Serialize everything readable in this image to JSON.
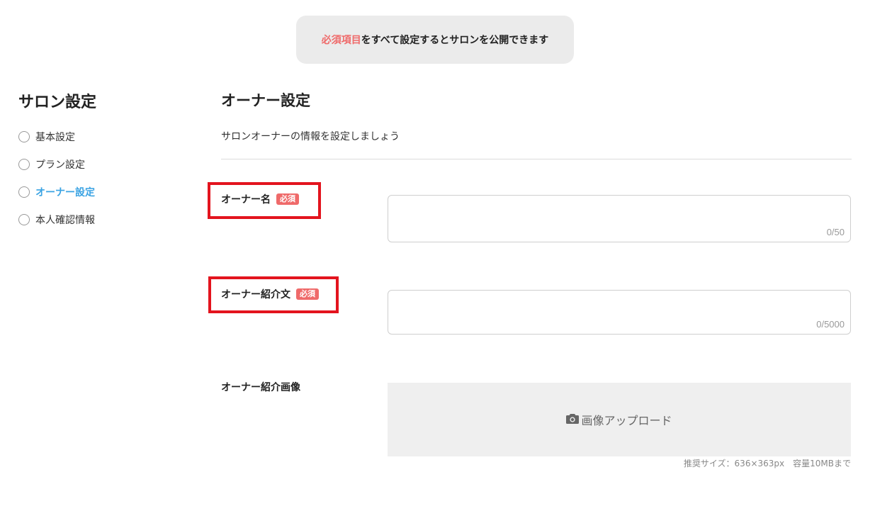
{
  "notice": {
    "required_text": "必須項目",
    "rest_text": "をすべて設定するとサロンを公開できます"
  },
  "sidebar": {
    "title": "サロン設定",
    "items": [
      {
        "label": "基本設定"
      },
      {
        "label": "プラン設定"
      },
      {
        "label": "オーナー設定"
      },
      {
        "label": "本人確認情報"
      }
    ]
  },
  "main": {
    "title": "オーナー設定",
    "subtitle": "サロンオーナーの情報を設定しましょう",
    "owner_name": {
      "label": "オーナー名",
      "badge": "必須",
      "value": "",
      "counter": "0/50"
    },
    "owner_intro": {
      "label": "オーナー紹介文",
      "badge": "必須",
      "value": "",
      "counter": "0/5000"
    },
    "owner_image": {
      "label": "オーナー紹介画像",
      "upload_label": "画像アップロード",
      "hint": "推奨サイズ：636×363px　容量10MBまで"
    }
  },
  "colors": {
    "accent": "#3aa3e3",
    "required": "#ef6a6a",
    "highlight_box": "#e3141e"
  }
}
